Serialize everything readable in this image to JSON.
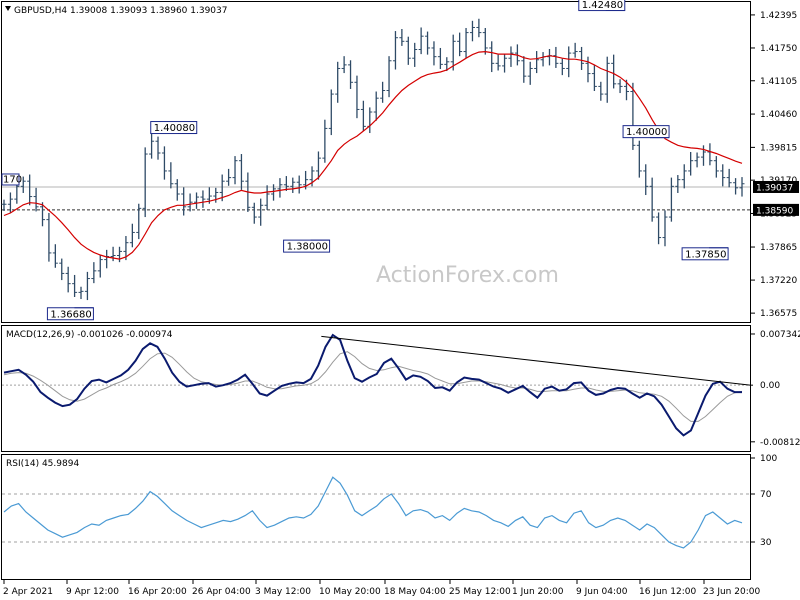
{
  "chart_data": [
    {
      "type": "candlestick",
      "title": "GBPUSD,H4  1.39008 1.39093 1.38960 1.39037",
      "watermark": "ActionForex.com",
      "ylim": [
        1.3648,
        1.4253
      ],
      "y_ticks": [
        1.42395,
        1.4175,
        1.4111,
        1.4046,
        1.3981,
        1.3917,
        1.3852,
        1.37865,
        1.3722,
        1.36575
      ],
      "y_tick_labels": [
        "1.42395",
        "1.41750",
        "1.41105",
        "1.40460",
        "1.39815",
        "1.39170",
        "1.38525",
        "1.37865",
        "1.37220",
        "1.36575"
      ],
      "x_labels": [
        "2 Apr 2021",
        "9 Apr 12:00",
        "16 Apr 20:00",
        "26 Apr 04:00",
        "3 May 12:00",
        "10 May 20:00",
        "18 May 04:00",
        "25 May 12:00",
        "1 Jun 20:00",
        "9 Jun 04:00",
        "16 Jun 12:00",
        "23 Jun 20:00"
      ],
      "current_price": 1.39037,
      "current_price_label": "1.39037",
      "support_line": 1.3859,
      "support_line_label": "1.38590",
      "left_edge_label": "170",
      "annotations": [
        {
          "text": "1.36680",
          "value": 1.3668,
          "at": 0.09
        },
        {
          "text": "1.40080",
          "value": 1.4008,
          "at": 0.23
        },
        {
          "text": "1.38000",
          "value": 1.38,
          "at": 0.41
        },
        {
          "text": "1.42480",
          "value": 1.4248,
          "at": 0.81
        },
        {
          "text": "1.40000",
          "value": 1.4,
          "at": 0.87
        },
        {
          "text": "1.37850",
          "value": 1.3785,
          "at": 0.95
        }
      ],
      "series": [
        {
          "name": "price",
          "color": "#2e4a66",
          "values": [
            1.387,
            1.388,
            1.3905,
            1.3915,
            1.3885,
            1.3865,
            1.384,
            1.3775,
            1.3755,
            1.3735,
            1.3715,
            1.3698,
            1.37,
            1.3725,
            1.374,
            1.3762,
            1.3768,
            1.377,
            1.3778,
            1.3795,
            1.3815,
            1.3862,
            1.3968,
            1.3993,
            1.397,
            1.3935,
            1.391,
            1.389,
            1.3865,
            1.3874,
            1.3884,
            1.388,
            1.3886,
            1.3893,
            1.3915,
            1.3922,
            1.3955,
            1.3915,
            1.3864,
            1.3845,
            1.3868,
            1.389,
            1.39,
            1.3908,
            1.3905,
            1.3913,
            1.3908,
            1.3918,
            1.3935,
            1.396,
            1.4018,
            1.4085,
            1.4135,
            1.4142,
            1.4108,
            1.4055,
            1.4022,
            1.405,
            1.4077,
            1.4092,
            1.415,
            1.4195,
            1.4188,
            1.4155,
            1.4172,
            1.4198,
            1.4175,
            1.4158,
            1.4143,
            1.4148,
            1.4188,
            1.4168,
            1.4205,
            1.4215,
            1.4205,
            1.4175,
            1.4145,
            1.414,
            1.4155,
            1.4165,
            1.415,
            1.412,
            1.4135,
            1.4152,
            1.4158,
            1.416,
            1.4145,
            1.4135,
            1.4165,
            1.4168,
            1.4145,
            1.4125,
            1.41,
            1.4085,
            1.4145,
            1.4105,
            1.41,
            1.409,
            1.3985,
            1.3935,
            1.3905,
            1.3845,
            1.3805,
            1.3845,
            1.3905,
            1.3918,
            1.3935,
            1.3955,
            1.3962,
            1.3972,
            1.3955,
            1.3935,
            1.3922,
            1.3912,
            1.3902,
            1.391
          ]
        },
        {
          "name": "ma",
          "color": "#d40000",
          "values": [
            1.3848,
            1.3853,
            1.3861,
            1.3869,
            1.3873,
            1.3872,
            1.3869,
            1.3858,
            1.3847,
            1.3834,
            1.382,
            1.3805,
            1.3792,
            1.3783,
            1.3776,
            1.3771,
            1.3767,
            1.3765,
            1.3763,
            1.3767,
            1.3776,
            1.3791,
            1.3812,
            1.3834,
            1.3848,
            1.3859,
            1.3864,
            1.3868,
            1.3868,
            1.387,
            1.3872,
            1.3874,
            1.3876,
            1.3879,
            1.3883,
            1.3887,
            1.3893,
            1.3897,
            1.3894,
            1.3892,
            1.3892,
            1.3894,
            1.3895,
            1.3897,
            1.3899,
            1.39,
            1.3902,
            1.3905,
            1.3912,
            1.3922,
            1.3938,
            1.3955,
            1.3975,
            1.3987,
            1.3996,
            1.4003,
            1.4013,
            1.4023,
            1.4035,
            1.4048,
            1.4064,
            1.4079,
            1.4092,
            1.4102,
            1.411,
            1.4118,
            1.4123,
            1.4126,
            1.4128,
            1.4132,
            1.414,
            1.4147,
            1.4155,
            1.4162,
            1.4167,
            1.4168,
            1.4166,
            1.4163,
            1.4163,
            1.4163,
            1.4161,
            1.4156,
            1.4153,
            1.4154,
            1.4157,
            1.416,
            1.4158,
            1.4155,
            1.4153,
            1.4153,
            1.4151,
            1.4148,
            1.4142,
            1.4135,
            1.413,
            1.4125,
            1.4118,
            1.4108,
            1.4095,
            1.4077,
            1.4058,
            1.4035,
            1.4015,
            1.3998,
            1.3991,
            1.3985,
            1.3982,
            1.398,
            1.3979,
            1.3977,
            1.3973,
            1.3969,
            1.3964,
            1.3959,
            1.3954,
            1.395
          ]
        }
      ]
    },
    {
      "type": "line",
      "title": "MACD(12,26,9) -0.001026 -0.000974",
      "ylim": [
        -0.0093,
        0.0082
      ],
      "y_ticks": [
        0.007342,
        0.0,
        -0.008126
      ],
      "y_tick_labels": [
        "0.007342",
        "0.00",
        "-0.008126"
      ],
      "zero_label": "0.00",
      "trendline": {
        "from": [
          0.43,
          0.007
        ],
        "to": [
          1.0,
          0.0
        ]
      },
      "series": [
        {
          "name": "macd",
          "color": "#0a1a6e",
          "values": [
            0.0018,
            0.002,
            0.0022,
            0.0015,
            0.0005,
            -0.001,
            -0.0018,
            -0.0025,
            -0.003,
            -0.0028,
            -0.002,
            -0.0005,
            0.0006,
            0.0008,
            0.0004,
            0.0009,
            0.0014,
            0.0022,
            0.0035,
            0.0052,
            0.006,
            0.0055,
            0.0038,
            0.0018,
            0.0005,
            -0.0002,
            0.0,
            0.0002,
            0.0003,
            -0.0002,
            0.0,
            0.0003,
            0.0008,
            0.0015,
            0.0002,
            -0.0012,
            -0.0015,
            -0.0008,
            -0.0001,
            0.0002,
            0.0004,
            0.0003,
            0.0009,
            0.0028,
            0.0055,
            0.0072,
            0.0065,
            0.0035,
            0.001,
            0.0005,
            0.0011,
            0.0016,
            0.0032,
            0.0038,
            0.0024,
            0.0008,
            0.0014,
            0.0012,
            0.0006,
            -0.0004,
            -0.0003,
            -0.0008,
            0.0004,
            0.0011,
            0.0009,
            0.0008,
            0.0003,
            -0.0002,
            -0.0005,
            -0.0011,
            -0.0006,
            -0.0001,
            -0.001,
            -0.0018,
            -0.0005,
            -0.0002,
            -0.0008,
            -0.0006,
            0.0003,
            0.0004,
            -0.0008,
            -0.0014,
            -0.0012,
            -0.0007,
            -0.0004,
            -0.0005,
            -0.0012,
            -0.0018,
            -0.0012,
            -0.0016,
            -0.0028,
            -0.0045,
            -0.0062,
            -0.0072,
            -0.0065,
            -0.004,
            -0.0015,
            0.0002,
            0.0005,
            -0.0005,
            -0.001,
            -0.001
          ]
        },
        {
          "name": "signal",
          "color": "#999999",
          "values": [
            0.0015,
            0.0017,
            0.0018,
            0.0017,
            0.0013,
            0.0007,
            0.0,
            -0.0008,
            -0.0016,
            -0.0021,
            -0.0023,
            -0.002,
            -0.0014,
            -0.0008,
            -0.0004,
            0.0001,
            0.0005,
            0.001,
            0.0017,
            0.0027,
            0.0038,
            0.0045,
            0.0046,
            0.004,
            0.003,
            0.0019,
            0.001,
            0.0005,
            0.0003,
            0.0001,
            0.0,
            0.0001,
            0.0003,
            0.0006,
            0.0006,
            0.0002,
            -0.0003,
            -0.0005,
            -0.0005,
            -0.0003,
            -0.0001,
            0.0,
            0.0002,
            0.0008,
            0.0019,
            0.0033,
            0.0045,
            0.0048,
            0.0041,
            0.0031,
            0.0024,
            0.0021,
            0.0022,
            0.0025,
            0.0027,
            0.0024,
            0.0021,
            0.0019,
            0.0016,
            0.001,
            0.0006,
            0.0002,
            0.0002,
            0.0004,
            0.0006,
            0.0006,
            0.0005,
            0.0003,
            0.0001,
            -0.0002,
            -0.0004,
            -0.0004,
            -0.0006,
            -0.0009,
            -0.0009,
            -0.0008,
            -0.0008,
            -0.0008,
            -0.0006,
            -0.0004,
            -0.0004,
            -0.0007,
            -0.0009,
            -0.0009,
            -0.0008,
            -0.0007,
            -0.0008,
            -0.0011,
            -0.0012,
            -0.0013,
            -0.0016,
            -0.0023,
            -0.0033,
            -0.0044,
            -0.0052,
            -0.0052,
            -0.0045,
            -0.0035,
            -0.0025,
            -0.0016,
            -0.0011,
            -0.0009
          ]
        }
      ]
    },
    {
      "type": "line",
      "title": "RSI(14) 45.9894",
      "ylim": [
        0,
        100
      ],
      "y_ticks": [
        100,
        70,
        30,
        0
      ],
      "y_tick_labels": [
        "100",
        "70",
        "30",
        "0"
      ],
      "levels": [
        70,
        30
      ],
      "series": [
        {
          "name": "rsi",
          "color": "#4a9ad4",
          "values": [
            55,
            60,
            62,
            55,
            50,
            45,
            40,
            37,
            34,
            36,
            38,
            42,
            45,
            44,
            48,
            50,
            52,
            53,
            58,
            64,
            72,
            68,
            62,
            56,
            52,
            48,
            45,
            42,
            44,
            46,
            48,
            47,
            49,
            52,
            56,
            48,
            42,
            44,
            47,
            50,
            51,
            50,
            53,
            60,
            72,
            84,
            79,
            69,
            56,
            52,
            56,
            60,
            66,
            70,
            62,
            52,
            56,
            57,
            55,
            50,
            52,
            48,
            54,
            58,
            56,
            55,
            52,
            48,
            46,
            43,
            48,
            51,
            44,
            42,
            50,
            52,
            48,
            46,
            54,
            56,
            46,
            42,
            44,
            48,
            50,
            48,
            44,
            40,
            45,
            42,
            36,
            30,
            27,
            25,
            30,
            40,
            52,
            55,
            50,
            45,
            48,
            46
          ]
        }
      ]
    }
  ]
}
